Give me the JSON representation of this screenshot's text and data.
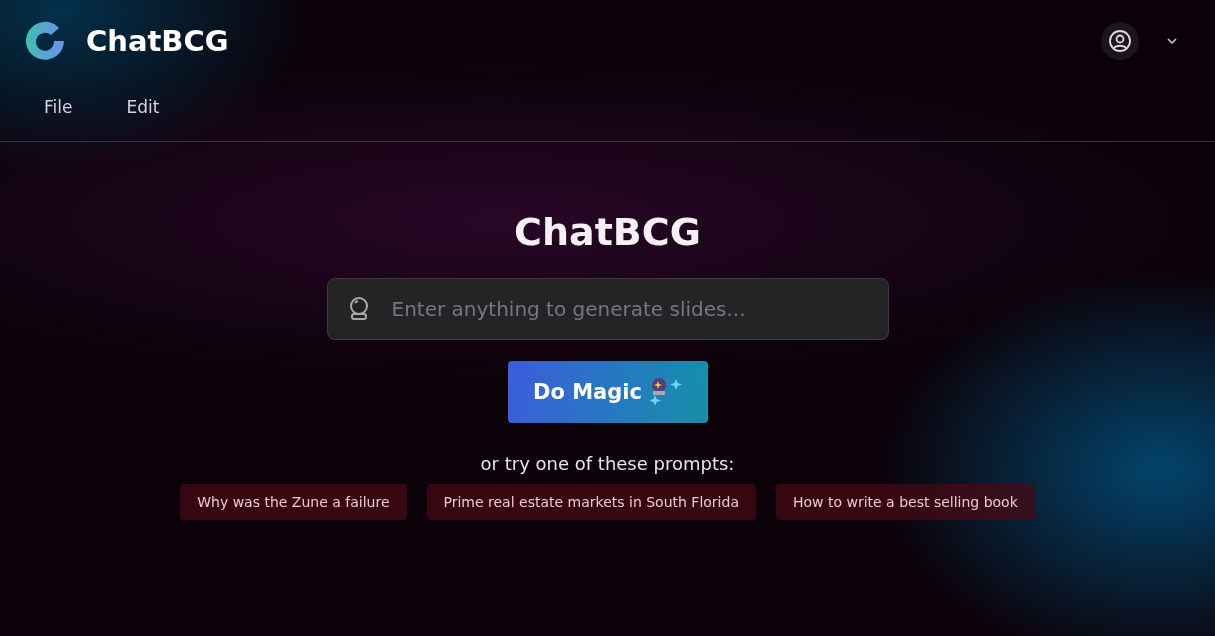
{
  "header": {
    "app_name": "ChatBCG"
  },
  "menu": [
    "File",
    "Edit"
  ],
  "main": {
    "title": "ChatBCG",
    "search": {
      "placeholder": "Enter anything to generate slides..."
    },
    "button": "Do Magic",
    "prompt_label": "or try one of these prompts:",
    "prompts": [
      "Why was the Zune a failure",
      "Prime real estate markets in South Florida",
      "How to write a best selling book"
    ]
  }
}
